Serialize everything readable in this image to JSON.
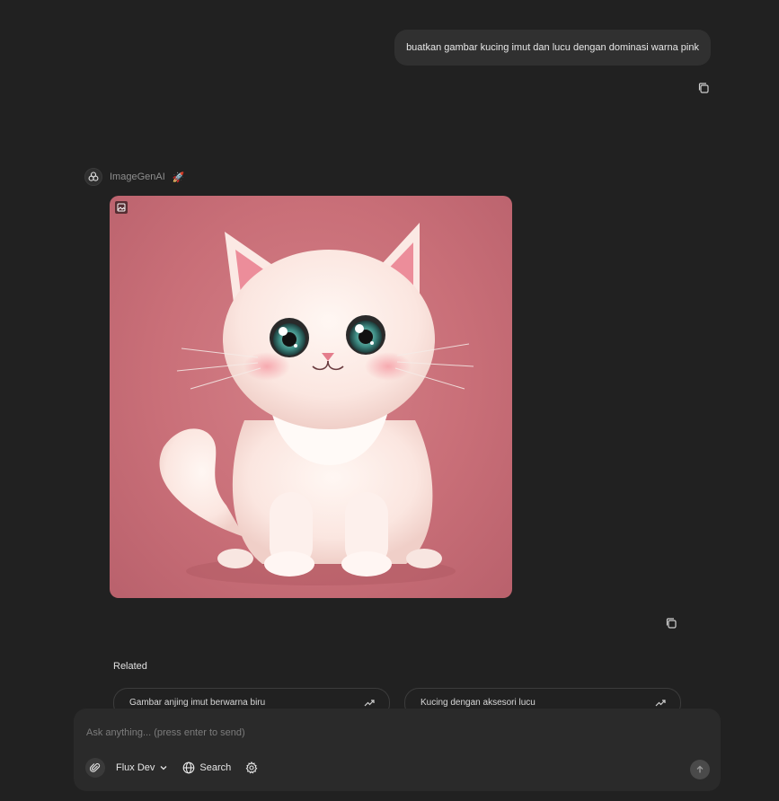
{
  "conversation": {
    "user_message": "buatkan gambar kucing imut dan lucu dengan dominasi warna pink",
    "assistant": {
      "name": "ImageGenAI",
      "emoji": "🚀"
    }
  },
  "related": {
    "title": "Related",
    "items": [
      {
        "label": "Gambar anjing imut berwarna biru"
      },
      {
        "label": "Kucing dengan aksesori lucu"
      }
    ]
  },
  "composer": {
    "placeholder": "Ask anything... (press enter to send)",
    "model_label": "Flux Dev",
    "search_label": "Search"
  },
  "icons": {
    "copy": "copy-icon",
    "attach": "paperclip-icon",
    "globe": "globe-icon",
    "settings": "gear-icon",
    "send": "arrow-up-icon",
    "trend": "trending-up-icon",
    "avatar": "openai-logo-icon",
    "image": "image-icon"
  },
  "colors": {
    "background": "#212121",
    "bubble": "#303030",
    "composer": "#2a2a2a",
    "image_bg": "#c96f78"
  }
}
